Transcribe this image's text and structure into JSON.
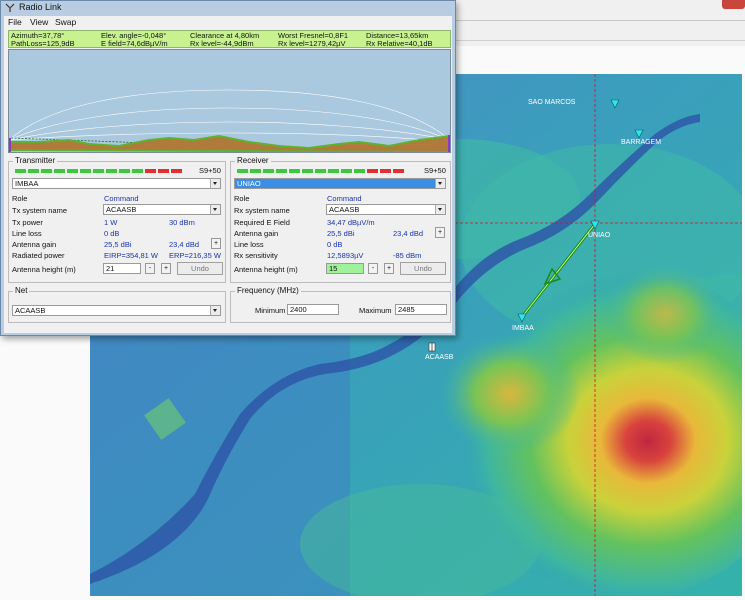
{
  "window": {
    "title": "Radio Link"
  },
  "menu": [
    "File",
    "View",
    "Swap"
  ],
  "info": {
    "row1": [
      "Azimuth=37,78°",
      "Elev. angle=-0,048°",
      "Clearance at 4,80km",
      "Worst Fresnel=0,8F1",
      "Distance=13,65km"
    ],
    "row2": [
      "PathLoss=125,9dB",
      "E field=74,6dBµV/m",
      "Rx level=-44,9dBm",
      "Rx level=1279,42µV",
      "Rx Relative=40,1dB"
    ]
  },
  "transmitter": {
    "title": "Transmitter",
    "signal": "S9+50",
    "station": "IMBAA",
    "role_label": "Role",
    "role_value": "Command",
    "system_label": "Tx system name",
    "system_value": "ACAASB",
    "power_label": "Tx power",
    "power_w": "1 W",
    "power_dbm": "30 dBm",
    "lineloss_label": "Line loss",
    "lineloss_value": "0 dB",
    "gain_label": "Antenna gain",
    "gain_dbi": "25,5 dBi",
    "gain_dbd": "23,4 dBd",
    "plus": "+",
    "radiated_label": "Radiated power",
    "eirp": "EIRP=354,81 W",
    "erp": "ERP=216,35 W",
    "height_label": "Antenna height (m)",
    "height_value": "21",
    "minus": "-",
    "undo": "Undo"
  },
  "receiver": {
    "title": "Receiver",
    "signal": "S9+50",
    "station": "UNIAO",
    "role_label": "Role",
    "role_value": "Command",
    "system_label": "Rx system name",
    "system_value": "ACAASB",
    "req_label": "Required E Field",
    "req_value": "34,47 dBµV/m",
    "gain_label": "Antenna gain",
    "gain_dbi": "25,5 dBi",
    "gain_dbd": "23,4 dBd",
    "plus": "+",
    "lineloss_label": "Line loss",
    "lineloss_value": "0 dB",
    "sens_label": "Rx sensitivity",
    "sens_uv": "12,5893µV",
    "sens_dbm": "-85 dBm",
    "height_label": "Antenna height (m)",
    "height_value": "15",
    "minus": "-",
    "undo": "Undo"
  },
  "net": {
    "title": "Net",
    "value": "ACAASB"
  },
  "frequency": {
    "title": "Frequency (MHz)",
    "min_label": "Minimum",
    "min_value": "2400",
    "max_label": "Maximum",
    "max_value": "2485"
  },
  "map_labels": {
    "sao_marcos": "SAO MARCOS",
    "barragem": "BARRAGEM",
    "uniao": "UNIAO",
    "imbaa": "IMBAA",
    "acaasb": "ACAASB"
  },
  "colors": {
    "info_bg": "#c7f28f",
    "terrain": "#5fb12e",
    "link_line": "#1a8a1a",
    "window_frame": "#b8cde2",
    "map_cursor": "#d0122a",
    "selected_combo": "#3a8ee6"
  }
}
